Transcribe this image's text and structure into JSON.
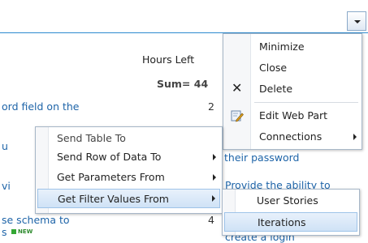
{
  "background": {
    "hours_left": "Hours Left",
    "sum": "Sum= 44",
    "row1_text": "ord field on the",
    "row1_num": "2",
    "row2_frag": "u",
    "row3_frag": "vi",
    "row4_text": "se schema to",
    "row4_num": "4",
    "row5_frag": "s",
    "new_label": "NEW",
    "right_text1": "their password",
    "right_text2": "Provide the ability to",
    "right_text3": "create a login"
  },
  "webpart_menu": {
    "items": [
      {
        "label": "Minimize"
      },
      {
        "label": "Close"
      },
      {
        "label": "Delete",
        "icon": "delete-x-icon"
      },
      {
        "label": "Edit Web Part",
        "icon": "edit-pencil-icon"
      },
      {
        "label": "Connections",
        "submenu": true
      }
    ]
  },
  "connections_menu": {
    "items": [
      {
        "label": "Send Table To"
      },
      {
        "label": "Send Row of Data To",
        "submenu": true
      },
      {
        "label": "Get Parameters From",
        "submenu": true
      },
      {
        "label": "Get Filter Values From",
        "submenu": true
      }
    ]
  },
  "filter_menu": {
    "items": [
      {
        "label": "User Stories"
      },
      {
        "label": "Iterations"
      }
    ]
  },
  "colors": {
    "accent": "#2d8bd0",
    "link": "#1e64a8",
    "highlight": "#cfe2f6"
  }
}
